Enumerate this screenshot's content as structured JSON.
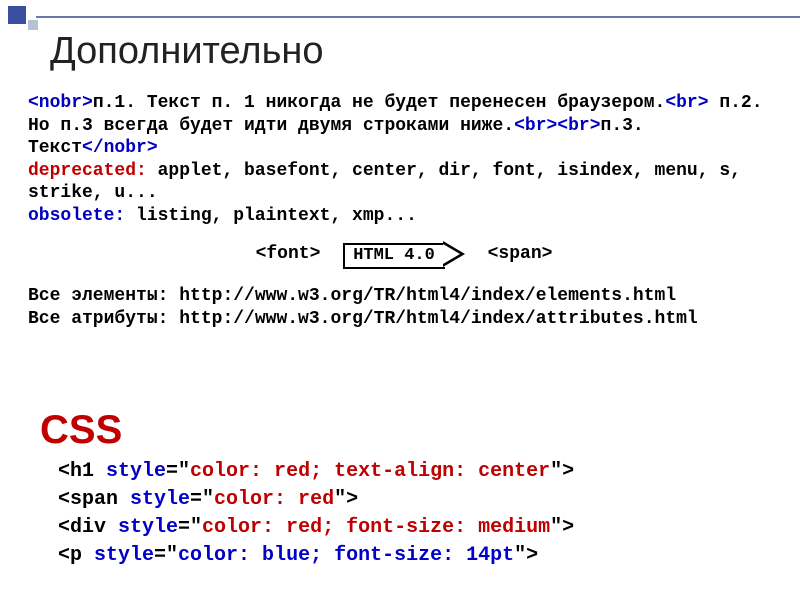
{
  "title": "Дополнительно",
  "nobr": {
    "open": "<nobr>",
    "close": "</nobr>",
    "text1": "п.1. Текст п. 1 никогда не будет перенесен браузером.",
    "br1": "<br>",
    "text2": " п.2. Но п.3 всегда будет идти двумя строками ниже.",
    "br2": "<br><br>",
    "text3": "п.3. Текст"
  },
  "deprecated": {
    "label": "deprecated:",
    "list": " applet, basefont, center, dir, font, isindex, menu, s, strike, u..."
  },
  "obsolete": {
    "label": "obsolete:",
    "list": " listing, plaintext, xmp..."
  },
  "arrow": {
    "left": "<font>",
    "mid": "HTML 4.0",
    "right": "<span>"
  },
  "links": {
    "elements_label": "  Все элементы: ",
    "elements_url": "http://www.w3.org/TR/html4/index/elements.html",
    "attrs_label": "Все атрибуты: ",
    "attrs_url": "http://www.w3.org/TR/html4/index/attributes.html"
  },
  "css_heading": "CSS",
  "css_examples": [
    {
      "tag": "<h1 ",
      "attr": "style",
      "eq": "=\"",
      "val": "color: red; text-align: center",
      "end": "\">",
      "valcolor": "red"
    },
    {
      "tag": "<span ",
      "attr": "style",
      "eq": "=\"",
      "val": "color: red",
      "end": "\">",
      "valcolor": "red"
    },
    {
      "tag": "<div ",
      "attr": "style",
      "eq": "=\"",
      "val": "color: red; font-size: medium",
      "end": "\">",
      "valcolor": "red"
    },
    {
      "tag": "<p ",
      "attr": "style",
      "eq": "=\"",
      "val": "color: blue; font-size: 14pt",
      "end": "\">",
      "valcolor": "blue"
    }
  ]
}
